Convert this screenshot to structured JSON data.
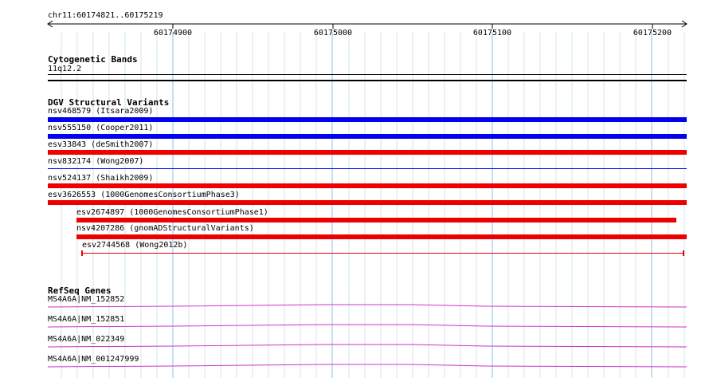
{
  "ruler": {
    "location": "chr11:60174821..60175219",
    "ticks": [
      "60174900",
      "60175000",
      "60175100",
      "60175200"
    ]
  },
  "tracks": {
    "cytoband": {
      "title": "Cytogenetic Bands",
      "band": "11q12.2"
    },
    "dgv": {
      "title": "DGV Structural Variants",
      "variants": [
        {
          "label": "nsv468579 (Itsara2009)",
          "color": "#0000ee"
        },
        {
          "label": "nsv555150 (Cooper2011)",
          "color": "#0000ee"
        },
        {
          "label": "esv33843 (deSmith2007)",
          "color": "#ee0000"
        },
        {
          "label": "nsv832174 (Wong2007)",
          "color": "#0000ee"
        },
        {
          "label": "nsv524137 (Shaikh2009)",
          "color": "#ee0000"
        },
        {
          "label": "esv3626553 (1000GenomesConsortiumPhase3)",
          "color": "#ee0000"
        },
        {
          "label": "esv2674897 (1000GenomesConsortiumPhase1)",
          "color": "#ee0000"
        },
        {
          "label": "nsv4207286 (gnomADStructuralVariants)",
          "color": "#ee0000"
        },
        {
          "label": "esv2744568 (Wong2012b)",
          "color": "#ee0000"
        }
      ]
    },
    "refseq": {
      "title": "RefSeq Genes",
      "color": "#cc33cc",
      "genes": [
        {
          "label": "MS4A6A|NM_152852"
        },
        {
          "label": "MS4A6A|NM_152851"
        },
        {
          "label": "MS4A6A|NM_022349"
        },
        {
          "label": "MS4A6A|NM_001247999"
        }
      ]
    }
  }
}
